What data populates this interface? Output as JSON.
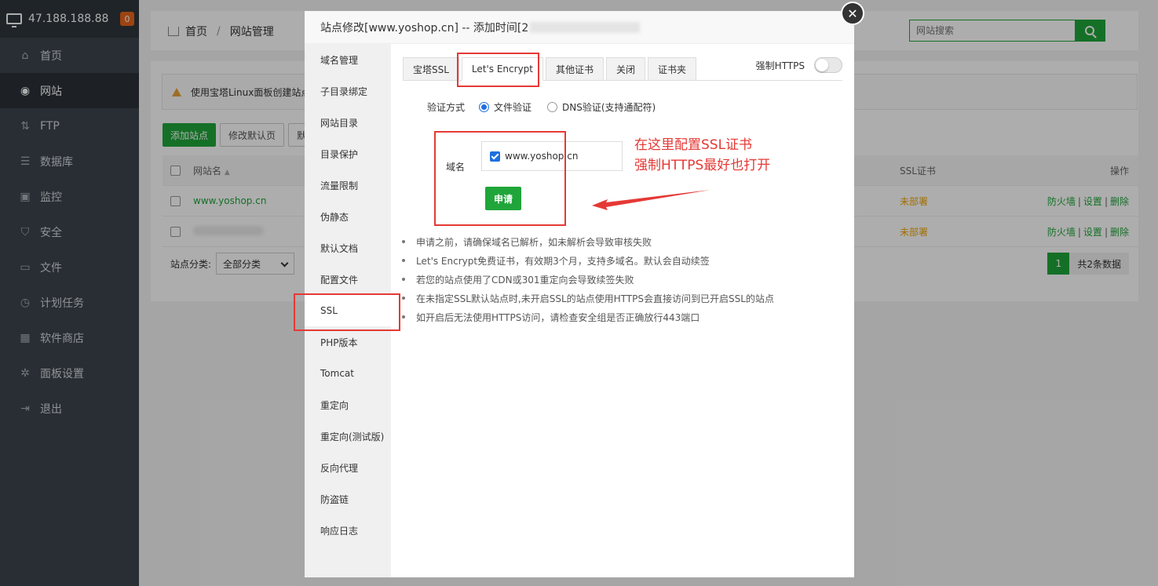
{
  "server": {
    "ip": "47.188.188.88",
    "badge": "0"
  },
  "sidebar": {
    "items": [
      {
        "label": "首页",
        "icon": "home-icon",
        "glyph": "⌂"
      },
      {
        "label": "网站",
        "icon": "globe-icon",
        "glyph": "◉"
      },
      {
        "label": "FTP",
        "icon": "ftp-icon",
        "glyph": "⇅"
      },
      {
        "label": "数据库",
        "icon": "database-icon",
        "glyph": "☰"
      },
      {
        "label": "监控",
        "icon": "monitor-icon",
        "glyph": "▣"
      },
      {
        "label": "安全",
        "icon": "shield-icon",
        "glyph": "⛉"
      },
      {
        "label": "文件",
        "icon": "folder-icon",
        "glyph": "▭"
      },
      {
        "label": "计划任务",
        "icon": "clock-icon",
        "glyph": "◷"
      },
      {
        "label": "软件商店",
        "icon": "grid-icon",
        "glyph": "▦"
      },
      {
        "label": "面板设置",
        "icon": "gear-icon",
        "glyph": "✲"
      },
      {
        "label": "退出",
        "icon": "logout-icon",
        "glyph": "⇥"
      }
    ]
  },
  "breadcrumb": {
    "home": "首页",
    "sep": "/",
    "current": "网站管理"
  },
  "search": {
    "placeholder": "网站搜索"
  },
  "notice": {
    "text": "使用宝塔Linux面板创建站点"
  },
  "toolbar": {
    "add_site": "添加站点",
    "edit_default": "修改默认页",
    "more": "默"
  },
  "table": {
    "headers": {
      "name": "网站名",
      "ssl": "SSL证书",
      "op": "操作"
    },
    "rows": [
      {
        "name": "www.yoshop.cn",
        "ssl": "未部署",
        "firewall": "防火墙",
        "settings": "设置",
        "delete": "删除"
      },
      {
        "name": "",
        "ssl": "未部署",
        "firewall": "防火墙",
        "settings": "设置",
        "delete": "删除"
      }
    ],
    "sep": "|"
  },
  "footer": {
    "category_label": "站点分类:",
    "category_value": "全部分类",
    "page": "1",
    "total": "共2条数据"
  },
  "modal": {
    "title": "站点修改[www.yoshop.cn] -- 添加时间[2",
    "close": "✕",
    "side_items": [
      "域名管理",
      "子目录绑定",
      "网站目录",
      "目录保护",
      "流量限制",
      "伪静态",
      "默认文档",
      "配置文件",
      "SSL",
      "PHP版本",
      "Tomcat",
      "重定向",
      "重定向(测试版)",
      "反向代理",
      "防盗链",
      "响应日志"
    ],
    "tabs": [
      "宝塔SSL",
      "Let's Encrypt",
      "其他证书",
      "关闭",
      "证书夹"
    ],
    "force_https": "强制HTTPS",
    "verify_label": "验证方式",
    "verify_file": "文件验证",
    "verify_dns": "DNS验证(支持通配符)",
    "domain_label": "域名",
    "domain_value": "www.yoshop.cn",
    "apply": "申请",
    "tips": [
      "申请之前，请确保域名已解析，如未解析会导致审核失败",
      "Let's Encrypt免费证书，有效期3个月，支持多域名。默认会自动续签",
      "若您的站点使用了CDN或301重定向会导致续签失败",
      "在未指定SSL默认站点时,未开启SSL的站点使用HTTPS会直接访问到已开启SSL的站点",
      "如开启后无法使用HTTPS访问，请检查安全组是否正确放行443端口"
    ]
  },
  "annotation": {
    "line1": "在这里配置SSL证书",
    "line2": "强制HTTPS最好也打开"
  },
  "colors": {
    "accent": "#20a53a",
    "annotation": "#e53935",
    "warning": "#f0a400"
  }
}
